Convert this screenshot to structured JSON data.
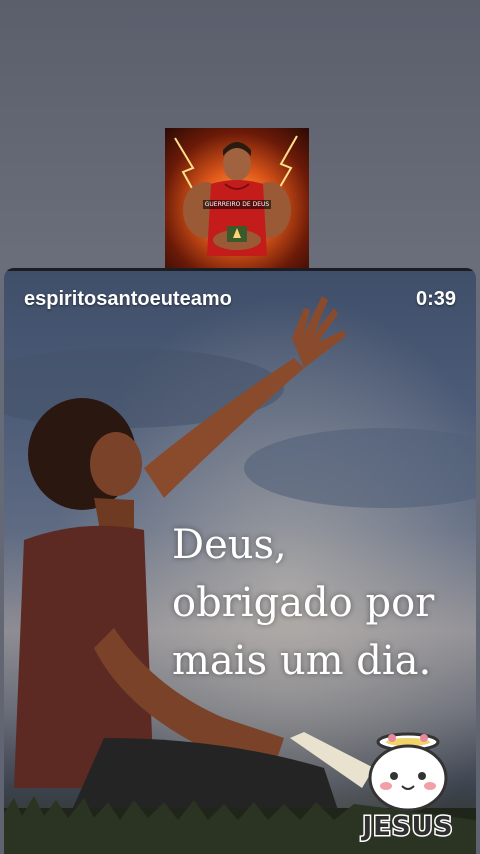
{
  "profile": {
    "thumbnail_label": "GUERREIRO DE DEUS"
  },
  "video": {
    "username": "espiritosantoeuteamo",
    "timer": "0:39",
    "caption_lines": [
      "Deus,",
      "obrigado por",
      "mais um dia."
    ]
  },
  "sticker": {
    "text": "JESUS"
  }
}
